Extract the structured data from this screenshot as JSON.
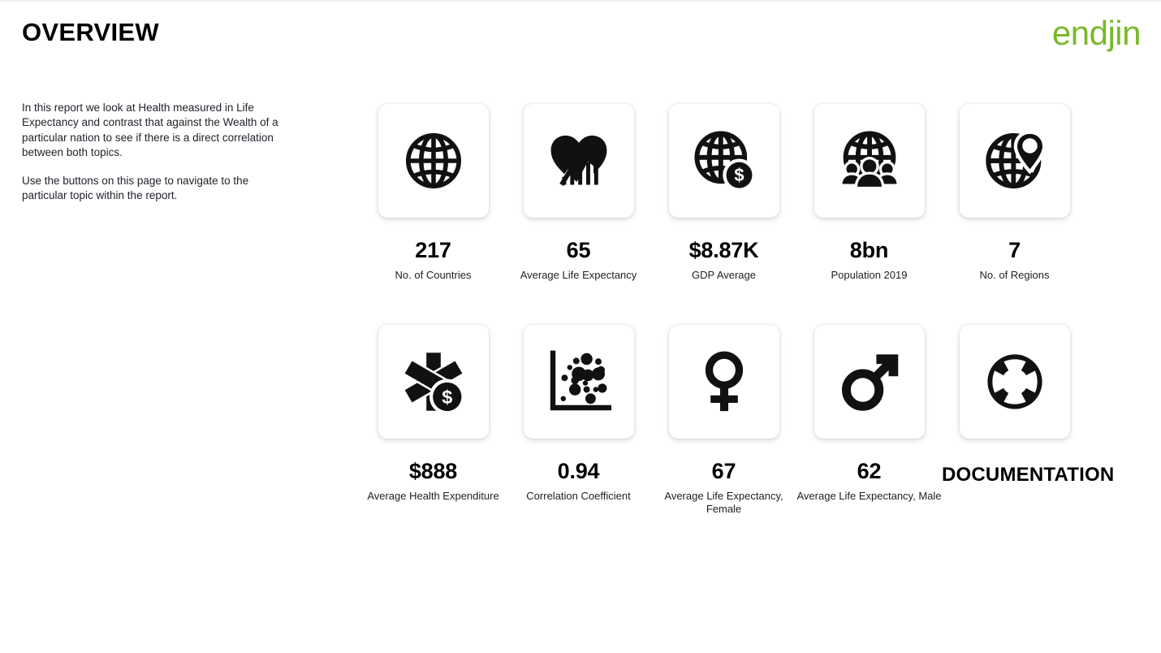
{
  "header": {
    "title": "OVERVIEW",
    "logo_text": "endjin",
    "logo_color": "#7ab929"
  },
  "intro": {
    "paragraph_1": "In this report we look at Health measured in Life Expectancy and contrast that against the Wealth of a particular nation to see if there is a direct correlation between both topics.",
    "paragraph_2": "Use the buttons on this page to navigate to the particular topic within the report."
  },
  "cards": {
    "row_1": [
      {
        "icon": "globe-icon",
        "value": "217",
        "label": "No. of Countries"
      },
      {
        "icon": "heart-trend-icon",
        "value": "65",
        "label": "Average Life Expectancy"
      },
      {
        "icon": "globe-dollar-icon",
        "value": "$8.87K",
        "label": "GDP Average"
      },
      {
        "icon": "globe-people-icon",
        "value": "8bn",
        "label": "Population 2019"
      },
      {
        "icon": "globe-pin-icon",
        "value": "7",
        "label": "No. of Regions"
      }
    ],
    "row_2": [
      {
        "icon": "star-of-life-dollar-icon",
        "value": "$888",
        "label": "Average Health Expenditure"
      },
      {
        "icon": "scatter-plot-icon",
        "value": "0.94",
        "label": "Correlation Coefficient"
      },
      {
        "icon": "female-symbol-icon",
        "value": "67",
        "label": "Average Life Expectancy, Female"
      },
      {
        "icon": "male-symbol-icon",
        "value": "62",
        "label": "Average Life Expectancy, Male"
      },
      {
        "icon": "life-ring-icon",
        "value": "DOCUMENTATION",
        "label": ""
      }
    ]
  }
}
